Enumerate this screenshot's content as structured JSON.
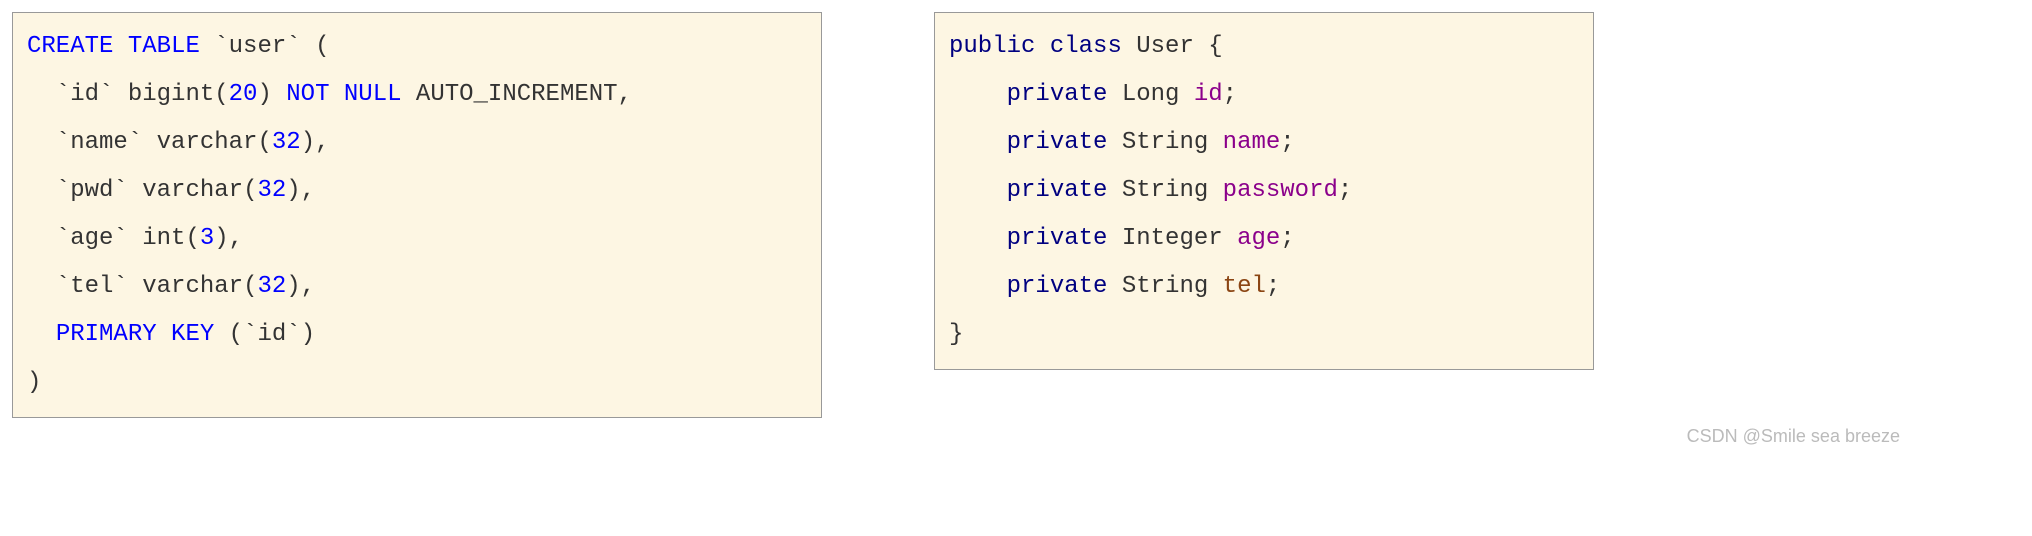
{
  "sql": {
    "create": "CREATE",
    "table": "TABLE",
    "user": "`user`",
    "open_paren": "(",
    "close_paren": ")",
    "id_col": "`id`",
    "bigint": "bigint",
    "num20": "20",
    "not": "NOT",
    "null": "NULL",
    "auto_inc": "AUTO_INCREMENT",
    "name_col": "`name`",
    "varchar": "varchar",
    "num32": "32",
    "pwd_col": "`pwd`",
    "age_col": "`age`",
    "int": "int",
    "num3": "3",
    "tel_col": "`tel`",
    "primary": "PRIMARY",
    "key": "KEY",
    "comma": ","
  },
  "java": {
    "public": "public",
    "class": "class",
    "user": "User",
    "open_brace": "{",
    "close_brace": "}",
    "private": "private",
    "long": "Long",
    "string": "String",
    "integer": "Integer",
    "id": "id",
    "name": "name",
    "password": "password",
    "age": "age",
    "tel": "tel",
    "semi": ";"
  },
  "watermark": "CSDN @Smile sea breeze"
}
